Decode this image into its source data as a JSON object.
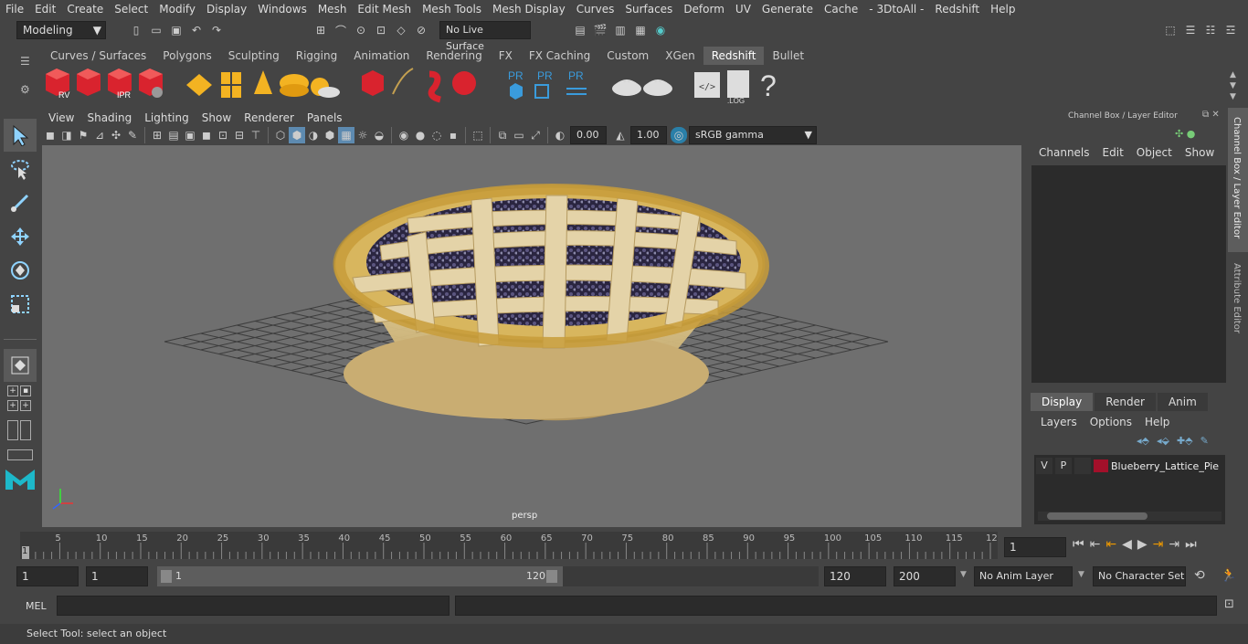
{
  "menu": [
    "File",
    "Edit",
    "Create",
    "Select",
    "Modify",
    "Display",
    "Windows",
    "Mesh",
    "Edit Mesh",
    "Mesh Tools",
    "Mesh Display",
    "Curves",
    "Surfaces",
    "Deform",
    "UV",
    "Generate",
    "Cache",
    "- 3DtoAll -",
    "Redshift",
    "Help"
  ],
  "status": {
    "workspace": "Modeling",
    "live_surface": "No Live Surface"
  },
  "shelf_tabs": [
    "Curves / Surfaces",
    "Polygons",
    "Sculpting",
    "Rigging",
    "Animation",
    "Rendering",
    "FX",
    "FX Caching",
    "Custom",
    "XGen",
    "Redshift",
    "Bullet"
  ],
  "shelf_active": "Redshift",
  "shelf_labels": {
    "rv": "RV",
    "ipr": "IPR",
    "pr1": "PR",
    "pr2": "PR",
    "pr3": "PR",
    "log": ".LOG",
    "help": "?"
  },
  "viewport": {
    "menu": [
      "View",
      "Shading",
      "Lighting",
      "Show",
      "Renderer",
      "Panels"
    ],
    "exposure": "0.00",
    "gamma": "1.00",
    "colorspace": "sRGB gamma",
    "camera": "persp"
  },
  "channel_box": {
    "title": "Channel Box / Layer Editor",
    "menu": [
      "Channels",
      "Edit",
      "Object",
      "Show"
    ],
    "layer_tabs": [
      "Display",
      "Render",
      "Anim"
    ],
    "layer_tab_active": "Display",
    "layer_menu": [
      "Layers",
      "Options",
      "Help"
    ],
    "layer": {
      "v": "V",
      "p": "P",
      "name": "Blueberry_Lattice_Pie",
      "color": "#a3102a"
    }
  },
  "side_tabs": [
    "Channel Box / Layer Editor",
    "Attribute Editor"
  ],
  "timeline": {
    "ticks": [
      "5",
      "10",
      "15",
      "20",
      "25",
      "30",
      "35",
      "40",
      "45",
      "50",
      "55",
      "60",
      "65",
      "70",
      "75",
      "80",
      "85",
      "90",
      "95",
      "100",
      "105",
      "110",
      "115",
      "12"
    ],
    "start_tick": "1",
    "current": "1"
  },
  "range": {
    "start": "1",
    "start2": "1",
    "slider_start": "1",
    "slider_end": "120",
    "end": "120",
    "anim_end": "200",
    "anim_layer": "No Anim Layer",
    "char_set": "No Character Set"
  },
  "cmd": {
    "lang": "MEL"
  },
  "help_text": "Select Tool: select an object",
  "colors": {
    "bg": "#444444",
    "viewport": "#6f6f6f",
    "accent": "#5d5d5d",
    "redshift_red": "#d9232e"
  }
}
